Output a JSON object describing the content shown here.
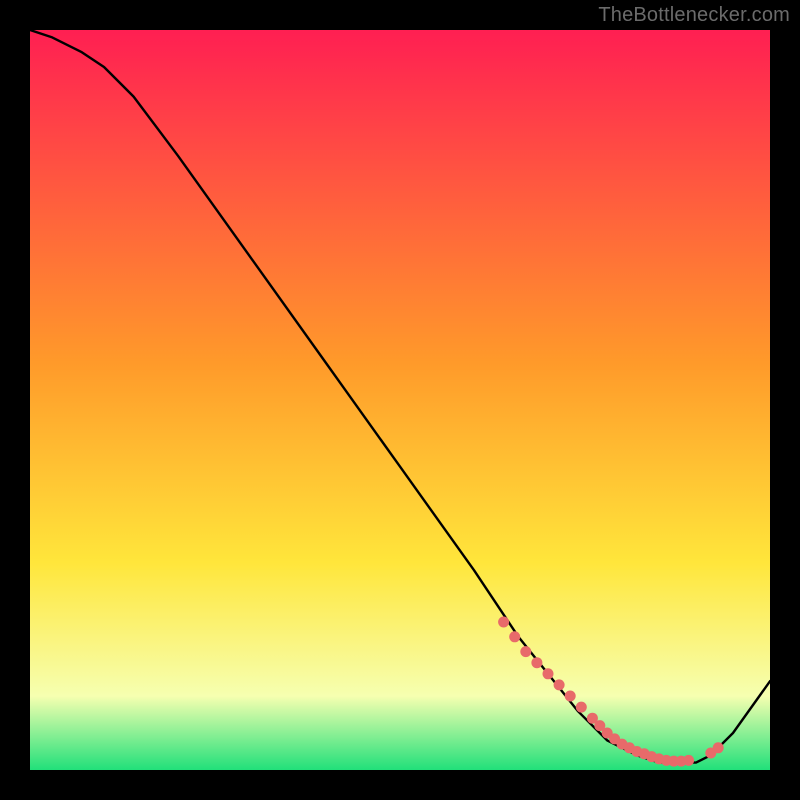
{
  "watermark": "TheBottlenecker.com",
  "colors": {
    "frame": "#000000",
    "curve": "#000000",
    "marker": "#e86a6a",
    "grad_top": "#ff1f52",
    "grad_mid1": "#ff9a2a",
    "grad_mid2": "#ffe63b",
    "grad_low": "#f6ffb0",
    "grad_bottom": "#21e07a"
  },
  "chart_data": {
    "type": "line",
    "title": "",
    "xlabel": "",
    "ylabel": "",
    "xlim": [
      0,
      100
    ],
    "ylim": [
      0,
      100
    ],
    "tick_labels": {
      "x": [],
      "y": []
    },
    "curve": {
      "x": [
        0,
        3,
        7,
        10,
        14,
        20,
        30,
        40,
        50,
        60,
        66,
        70,
        74,
        78,
        82,
        85,
        88,
        90,
        92,
        95,
        100
      ],
      "y": [
        100,
        99,
        97,
        95,
        91,
        83,
        69,
        55,
        41,
        27,
        18,
        13,
        8,
        4,
        2,
        1,
        1,
        1,
        2,
        5,
        12
      ]
    },
    "marker_series": {
      "name": "highlighted-points",
      "x": [
        64,
        65.5,
        67,
        68.5,
        70,
        71.5,
        73,
        74.5,
        76,
        77,
        78,
        79,
        80,
        81,
        82,
        83,
        84,
        85,
        86,
        87,
        88,
        89,
        92,
        93
      ],
      "y": [
        20,
        18,
        16,
        14.5,
        13,
        11.5,
        10,
        8.5,
        7,
        6,
        5,
        4.2,
        3.5,
        3,
        2.5,
        2.2,
        1.8,
        1.5,
        1.3,
        1.2,
        1.2,
        1.3,
        2.3,
        3
      ]
    }
  }
}
